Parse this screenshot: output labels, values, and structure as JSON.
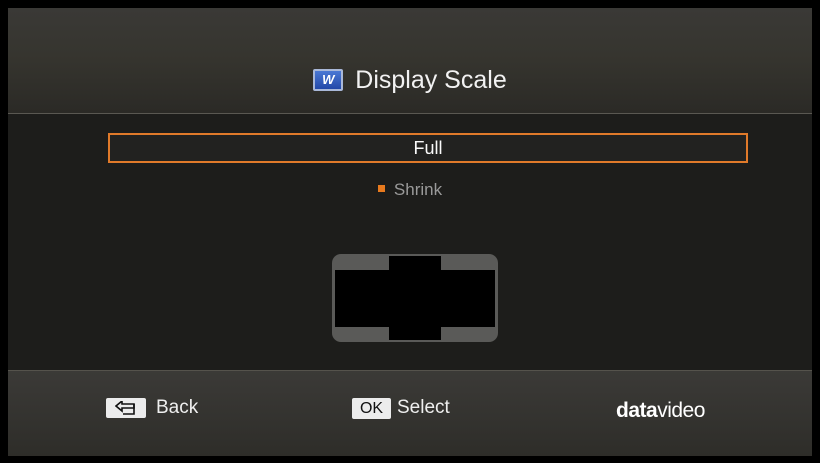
{
  "header": {
    "title": "Display Scale",
    "icon": "w-app-icon",
    "icon_letter": "W"
  },
  "menu": {
    "selected_option": "Full",
    "other_option": "Shrink",
    "highlight_color": "#e07a2a"
  },
  "preview": {
    "icon": "display-scale-preview"
  },
  "footer": {
    "back_label": "Back",
    "back_icon": "return-arrow-icon",
    "ok_key": "OK",
    "select_label": "Select",
    "logo_bold": "data",
    "logo_light": "video"
  }
}
